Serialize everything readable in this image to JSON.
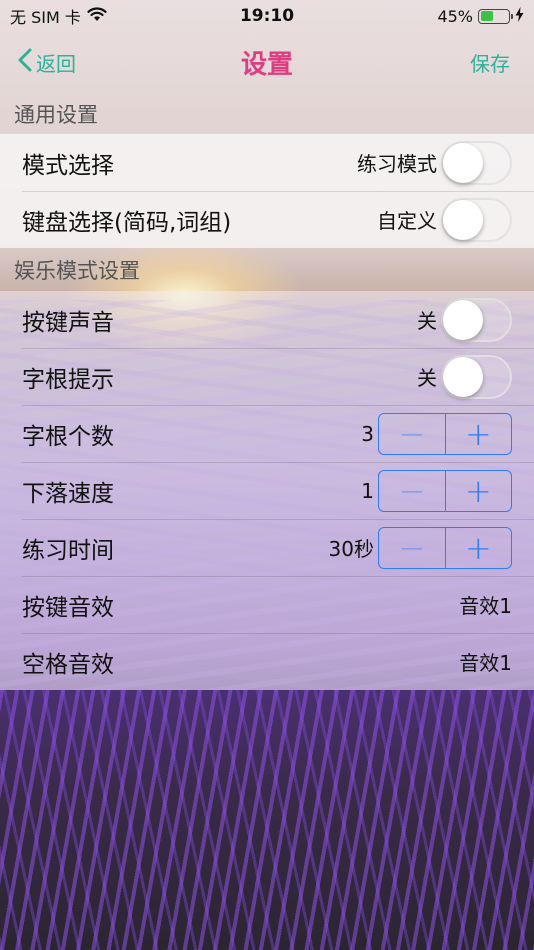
{
  "status_bar": {
    "carrier": "无 SIM 卡",
    "time": "19:10",
    "battery_percent": "45%",
    "battery_level": 0.45
  },
  "nav": {
    "back_label": "返回",
    "title": "设置",
    "save_label": "保存"
  },
  "sections": [
    {
      "header": "通用设置",
      "rows": [
        {
          "label": "模式选择",
          "value": "练习模式",
          "control": "switch",
          "on": false
        },
        {
          "label": "键盘选择(简码,词组)",
          "value": "自定义",
          "control": "switch",
          "on": false
        }
      ]
    },
    {
      "header": "娱乐模式设置",
      "rows": [
        {
          "label": "按键声音",
          "value": "关",
          "control": "switch",
          "on": false
        },
        {
          "label": "字根提示",
          "value": "关",
          "control": "switch",
          "on": false
        },
        {
          "label": "字根个数",
          "value": "3",
          "control": "stepper"
        },
        {
          "label": "下落速度",
          "value": "1",
          "control": "stepper"
        },
        {
          "label": "练习时间",
          "value": "30秒",
          "control": "stepper"
        },
        {
          "label": "按键音效",
          "value": "音效1",
          "control": "none"
        },
        {
          "label": "空格音效",
          "value": "音效1",
          "control": "none"
        }
      ]
    }
  ],
  "stepper_symbols": {
    "minus": "−",
    "plus": "+"
  },
  "colors": {
    "accent_green": "#2bb39a",
    "title_pink": "#e03c82",
    "stepper_blue": "#2d7df6",
    "battery_green": "#3cc04a"
  },
  "icons": [
    "wifi-icon",
    "battery-icon",
    "charging-bolt-icon",
    "chevron-left-icon"
  ]
}
